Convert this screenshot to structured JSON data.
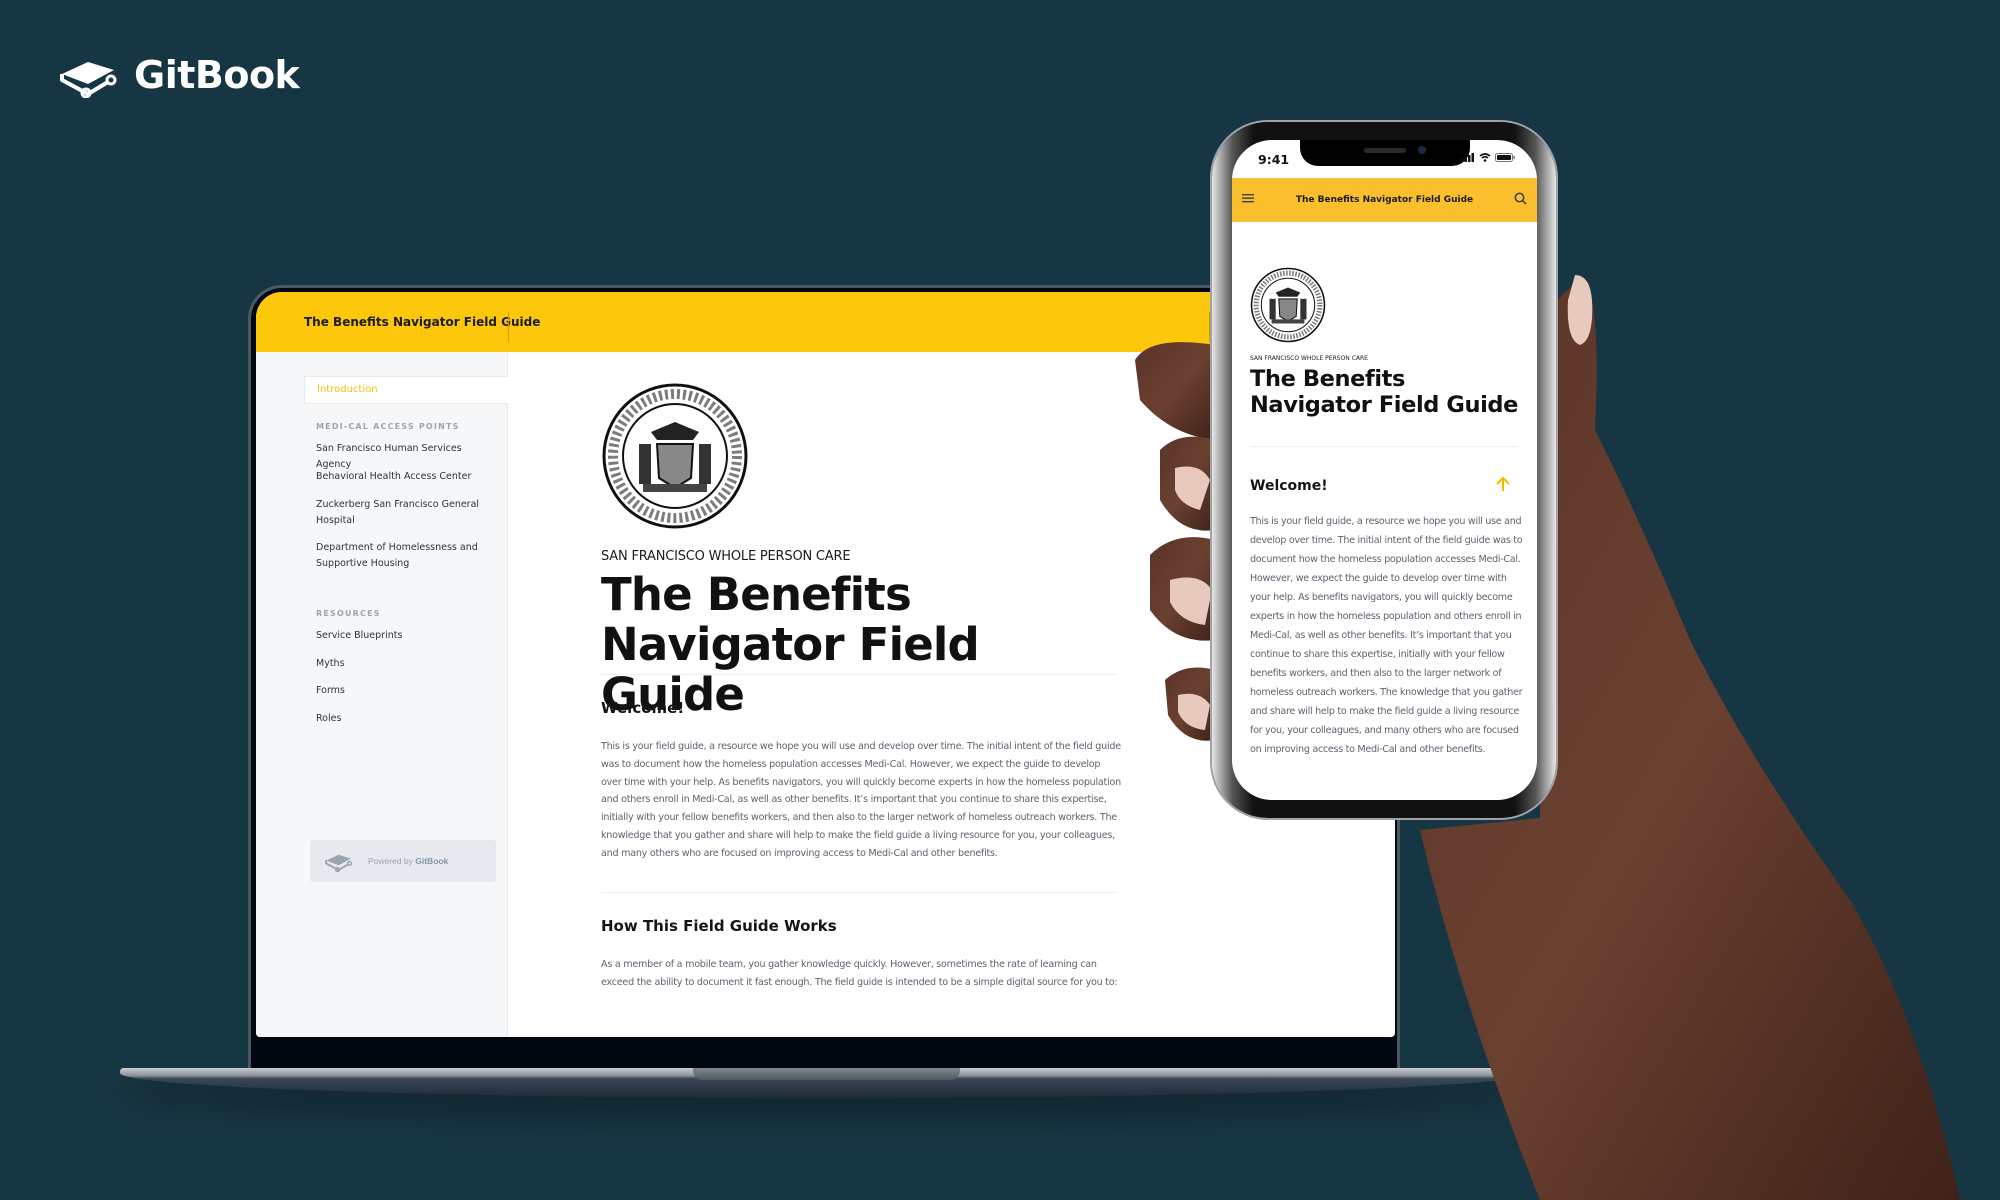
{
  "brand": {
    "name": "GitBook",
    "icon": "gitbook-logo-icon"
  },
  "colors": {
    "background": "#173643",
    "accent": "#fdc70b",
    "mobile_accent": "#fbbf2e",
    "active_nav": "#f5c10a"
  },
  "laptop": {
    "header": {
      "title": "The Benefits Navigator Field Guide"
    },
    "sidebar": {
      "active_item": "Introduction",
      "groups": [
        {
          "title": "MEDI-CAL ACCESS POINTS",
          "items": [
            "San Francisco Human Services Agency",
            "Behavioral Health Access Center",
            "Zuckerberg San Francisco General Hospital",
            "Department of Homelessness and Supportive Housing"
          ]
        },
        {
          "title": "RESOURCES",
          "items": [
            "Service Blueprints",
            "Myths",
            "Forms",
            "Roles"
          ]
        }
      ],
      "powered_by": {
        "prefix": "Powered by ",
        "brand": "GitBook"
      }
    },
    "content": {
      "seal_alt": "Seal of the City and County of San Francisco",
      "kicker": "SAN FRANCISCO WHOLE PERSON CARE",
      "title": "The Benefits Navigator Field Guide",
      "sections": [
        {
          "heading": "Welcome!",
          "body": "This is your field guide, a resource we hope you will use and develop over time. The initial intent of the field guide was to document how the homeless population accesses Medi-Cal. However, we expect the guide to develop over time with your help. As benefits navigators, you will quickly become experts in how the homeless population and others enroll in Medi-Cal, as well as other benefits. It’s important that you continue to share this expertise, initially with your fellow benefits workers, and then also to the larger network of homeless outreach workers. The knowledge that you gather and share will help to make the field guide a living resource for you, your colleagues, and many others who are focused on improving access to Medi-Cal and other benefits."
        },
        {
          "heading": "How This Field Guide Works",
          "body": "As a member of a mobile team, you gather knowledge quickly. However, sometimes the rate of learning can exceed the ability to document it fast enough. The field guide is intended to be a simple digital source for you to:"
        }
      ]
    }
  },
  "phone": {
    "status_bar": {
      "time": "9:41",
      "icons": [
        "signal-icon",
        "wifi-icon",
        "battery-icon"
      ]
    },
    "header": {
      "title": "The Benefits Navigator Field Guide",
      "menu_icon": "hamburger-menu-icon",
      "search_icon": "search-icon"
    },
    "content": {
      "kicker": "SAN FRANCISCO WHOLE PERSON CARE",
      "title": "The Benefits Navigator Field Guide",
      "heading": "Welcome!",
      "anchor_icon": "arrow-up-icon",
      "body": "This is your field guide, a resource we hope you will use and develop over time. The initial intent of the field guide was to document how the homeless population accesses Medi-Cal. However, we expect the guide to develop over time with your help. As benefits navigators, you will quickly become experts in how the homeless population and others enroll in Medi-Cal, as well as other benefits. It’s important that you continue to share this expertise, initially with your fellow benefits workers, and then also to the larger network of homeless outreach workers. The knowledge that you gather and share will help to make the field guide a living resource for you, your colleagues, and many others who are focused on improving access to Medi-Cal and other benefits."
    }
  }
}
